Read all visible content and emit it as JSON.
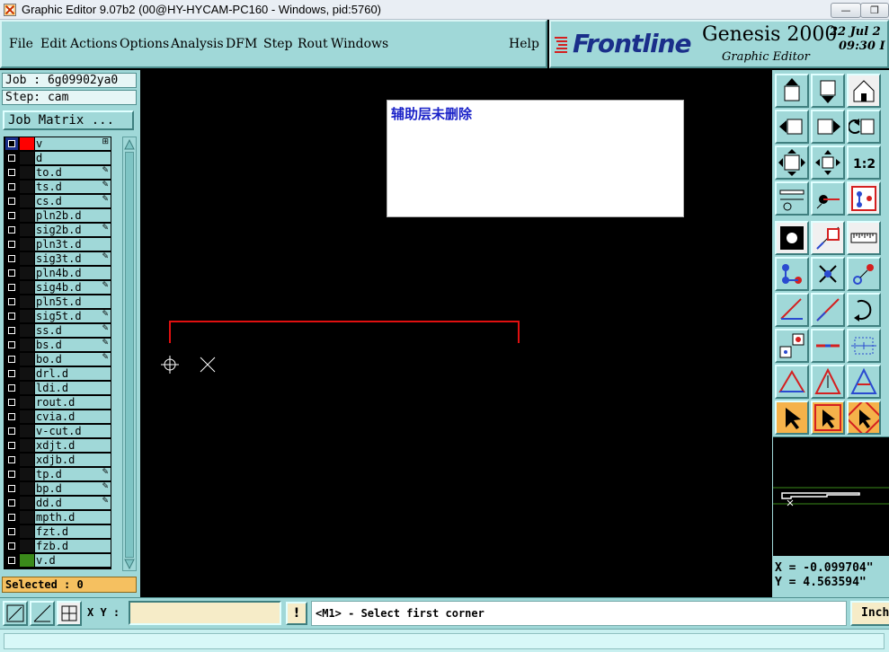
{
  "window": {
    "title": "Graphic Editor 9.07b2 (00@HY-HYCAM-PC160 - Windows, pid:5760)",
    "minimize_label": "—",
    "maximize_label": "❐"
  },
  "menu": {
    "items": [
      "File",
      "Edit",
      "Actions",
      "Options",
      "Analysis",
      "DFM",
      "Step",
      "Rout",
      "Windows"
    ],
    "help": "Help"
  },
  "brand": {
    "logo": "Frontline",
    "product": "Genesis 2000",
    "subtitle": "Graphic Editor",
    "date": "22 Jul 2",
    "time": "09:30 I"
  },
  "job": {
    "job_label": "Job : 6g09902ya0",
    "step_label": "Step: cam",
    "matrix_button": "Job Matrix ..."
  },
  "layers": [
    {
      "name": "v",
      "color": "#ff0000",
      "checked": true,
      "mark": "⊞"
    },
    {
      "name": "d",
      "color": "#111111",
      "checked": false,
      "mark": ""
    },
    {
      "name": "to.d",
      "color": "#111111",
      "checked": false,
      "mark": "✎"
    },
    {
      "name": "ts.d",
      "color": "#111111",
      "checked": false,
      "mark": "✎"
    },
    {
      "name": "cs.d",
      "color": "#111111",
      "checked": false,
      "mark": "✎"
    },
    {
      "name": "pln2b.d",
      "color": "#111111",
      "checked": false,
      "mark": ""
    },
    {
      "name": "sig2b.d",
      "color": "#111111",
      "checked": false,
      "mark": "✎"
    },
    {
      "name": "pln3t.d",
      "color": "#111111",
      "checked": false,
      "mark": ""
    },
    {
      "name": "sig3t.d",
      "color": "#111111",
      "checked": false,
      "mark": "✎"
    },
    {
      "name": "pln4b.d",
      "color": "#111111",
      "checked": false,
      "mark": ""
    },
    {
      "name": "sig4b.d",
      "color": "#111111",
      "checked": false,
      "mark": "✎"
    },
    {
      "name": "pln5t.d",
      "color": "#111111",
      "checked": false,
      "mark": ""
    },
    {
      "name": "sig5t.d",
      "color": "#111111",
      "checked": false,
      "mark": "✎"
    },
    {
      "name": "ss.d",
      "color": "#111111",
      "checked": false,
      "mark": "✎"
    },
    {
      "name": "bs.d",
      "color": "#111111",
      "checked": false,
      "mark": "✎"
    },
    {
      "name": "bo.d",
      "color": "#111111",
      "checked": false,
      "mark": "✎"
    },
    {
      "name": "drl.d",
      "color": "#111111",
      "checked": false,
      "mark": ""
    },
    {
      "name": "ldi.d",
      "color": "#111111",
      "checked": false,
      "mark": ""
    },
    {
      "name": "rout.d",
      "color": "#111111",
      "checked": false,
      "mark": ""
    },
    {
      "name": "cvia.d",
      "color": "#111111",
      "checked": false,
      "mark": ""
    },
    {
      "name": "v-cut.d",
      "color": "#111111",
      "checked": false,
      "mark": ""
    },
    {
      "name": "xdjt.d",
      "color": "#111111",
      "checked": false,
      "mark": ""
    },
    {
      "name": "xdjb.d",
      "color": "#111111",
      "checked": false,
      "mark": ""
    },
    {
      "name": "tp.d",
      "color": "#111111",
      "checked": false,
      "mark": "✎"
    },
    {
      "name": "bp.d",
      "color": "#111111",
      "checked": false,
      "mark": "✎"
    },
    {
      "name": "dd.d",
      "color": "#111111",
      "checked": false,
      "mark": "✎"
    },
    {
      "name": "mpth.d",
      "color": "#111111",
      "checked": false,
      "mark": ""
    },
    {
      "name": "fzt.d",
      "color": "#111111",
      "checked": false,
      "mark": ""
    },
    {
      "name": "fzb.d",
      "color": "#111111",
      "checked": false,
      "mark": ""
    },
    {
      "name": "v.d",
      "color": "#3a8a1a",
      "checked": false,
      "mark": ""
    }
  ],
  "selected": "Selected : 0",
  "canvas": {
    "message": "辅助层未删除"
  },
  "toolbar_icons": [
    [
      "move-up-icon",
      "move-down-icon",
      "home-icon"
    ],
    [
      "move-left-icon",
      "move-right-icon",
      "undo-icon"
    ],
    [
      "fit-screen-icon",
      "zoom-center-icon",
      "scale-1-2-icon"
    ],
    [
      "measure-tools-icon",
      "snap-icon",
      "layer-select-icon"
    ],
    [
      "fill-icon",
      "draw-polygon-icon",
      "ruler-icon"
    ],
    [
      "connect-icon",
      "delete-node-icon",
      "add-pad-icon"
    ],
    [
      "draw-line-icon",
      "draw-diagonal-icon",
      "arc-icon"
    ],
    [
      "pad-select-icon",
      "horizontal-line-icon",
      "fit-box-icon"
    ],
    [
      "triangle-icon",
      "triangle-arrow-icon",
      "triangle-move-icon"
    ],
    [
      "select-pointer-icon",
      "select-box-icon",
      "select-zoom-icon"
    ]
  ],
  "coords": {
    "x": "X = -0.099704\"",
    "y": "Y = 4.563594\""
  },
  "bottom": {
    "xy_label": "X Y :",
    "xy_value": "",
    "warn": "!",
    "prompt": "<M1> - Select first corner",
    "units": "Inch"
  }
}
